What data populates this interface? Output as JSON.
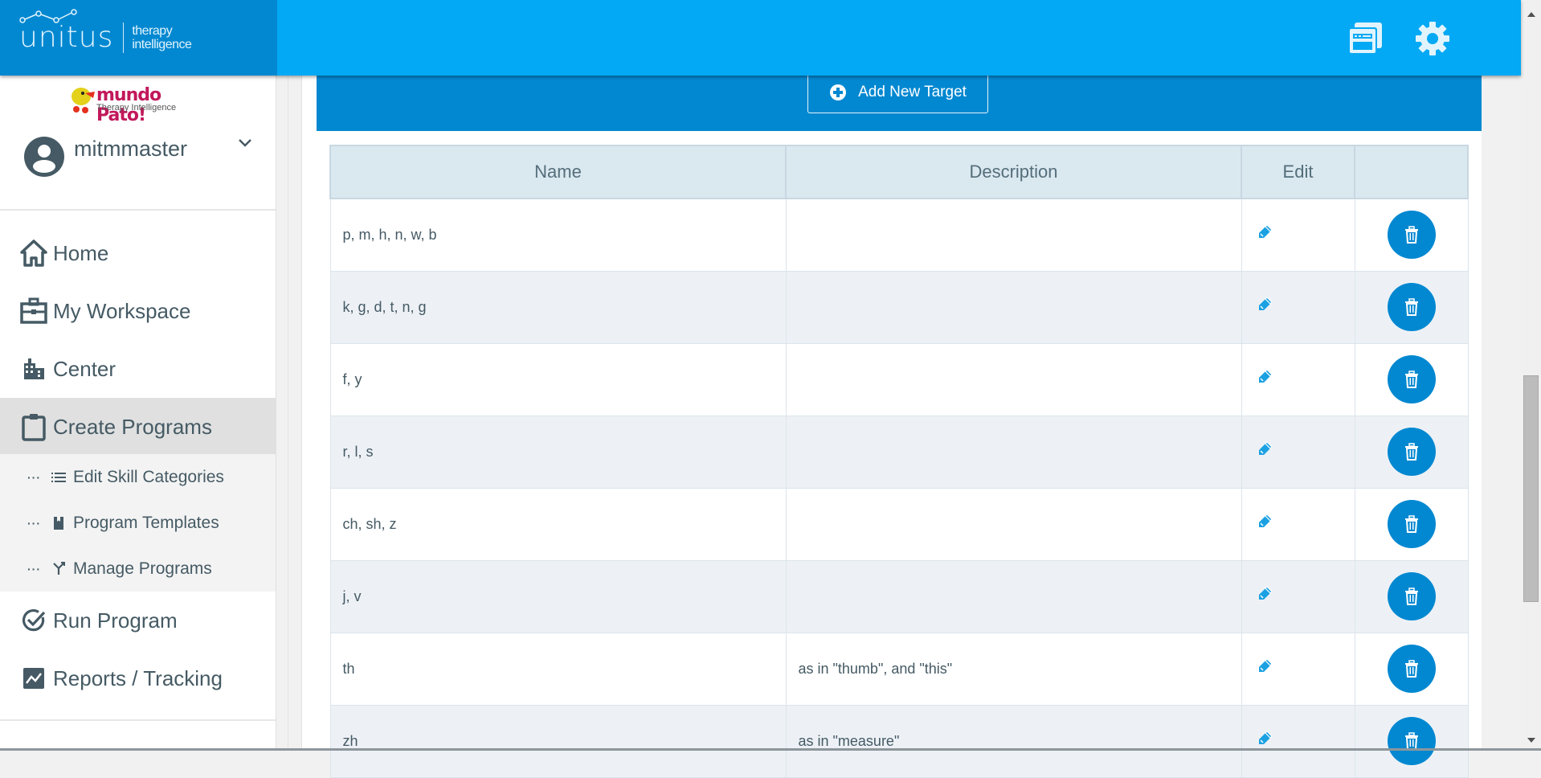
{
  "header": {
    "brand_name": "unitus",
    "brand_tagline_line1": "therapy",
    "brand_tagline_line2": "intelligence",
    "icons": [
      "windows-icon",
      "gear-icon"
    ],
    "colors": {
      "topbar": "#03a9f4",
      "brand": "#0288d1"
    }
  },
  "sidebar": {
    "org_logo_title": "mundo Pato!",
    "org_logo_subtitle": "Therapy Intelligence",
    "username": "mitmmaster",
    "items": [
      {
        "label": "Home",
        "icon": "home-icon"
      },
      {
        "label": "My Workspace",
        "icon": "briefcase-icon"
      },
      {
        "label": "Center",
        "icon": "building-icon"
      },
      {
        "label": "Create Programs",
        "icon": "clipboard-icon",
        "active": true
      },
      {
        "label": "Run Program",
        "icon": "check-circle-icon"
      },
      {
        "label": "Reports / Tracking",
        "icon": "chart-icon"
      }
    ],
    "subitems": [
      {
        "label": "Edit Skill Categories",
        "icon": "list-icon"
      },
      {
        "label": "Program Templates",
        "icon": "bookmark-icon"
      },
      {
        "label": "Manage Programs",
        "icon": "fork-icon"
      }
    ]
  },
  "main": {
    "add_button_label": "Add New Target",
    "table": {
      "columns": [
        "Name",
        "Description",
        "Edit",
        ""
      ],
      "rows": [
        {
          "name": "p, m, h, n, w, b",
          "description": ""
        },
        {
          "name": "k, g, d, t, n, g",
          "description": ""
        },
        {
          "name": "f, y",
          "description": ""
        },
        {
          "name": "r, l, s",
          "description": ""
        },
        {
          "name": "ch, sh, z",
          "description": ""
        },
        {
          "name": "j, v",
          "description": ""
        },
        {
          "name": "th",
          "description": "as in \"thumb\", and \"this\""
        },
        {
          "name": "zh",
          "description": "as in \"measure\""
        }
      ]
    }
  }
}
